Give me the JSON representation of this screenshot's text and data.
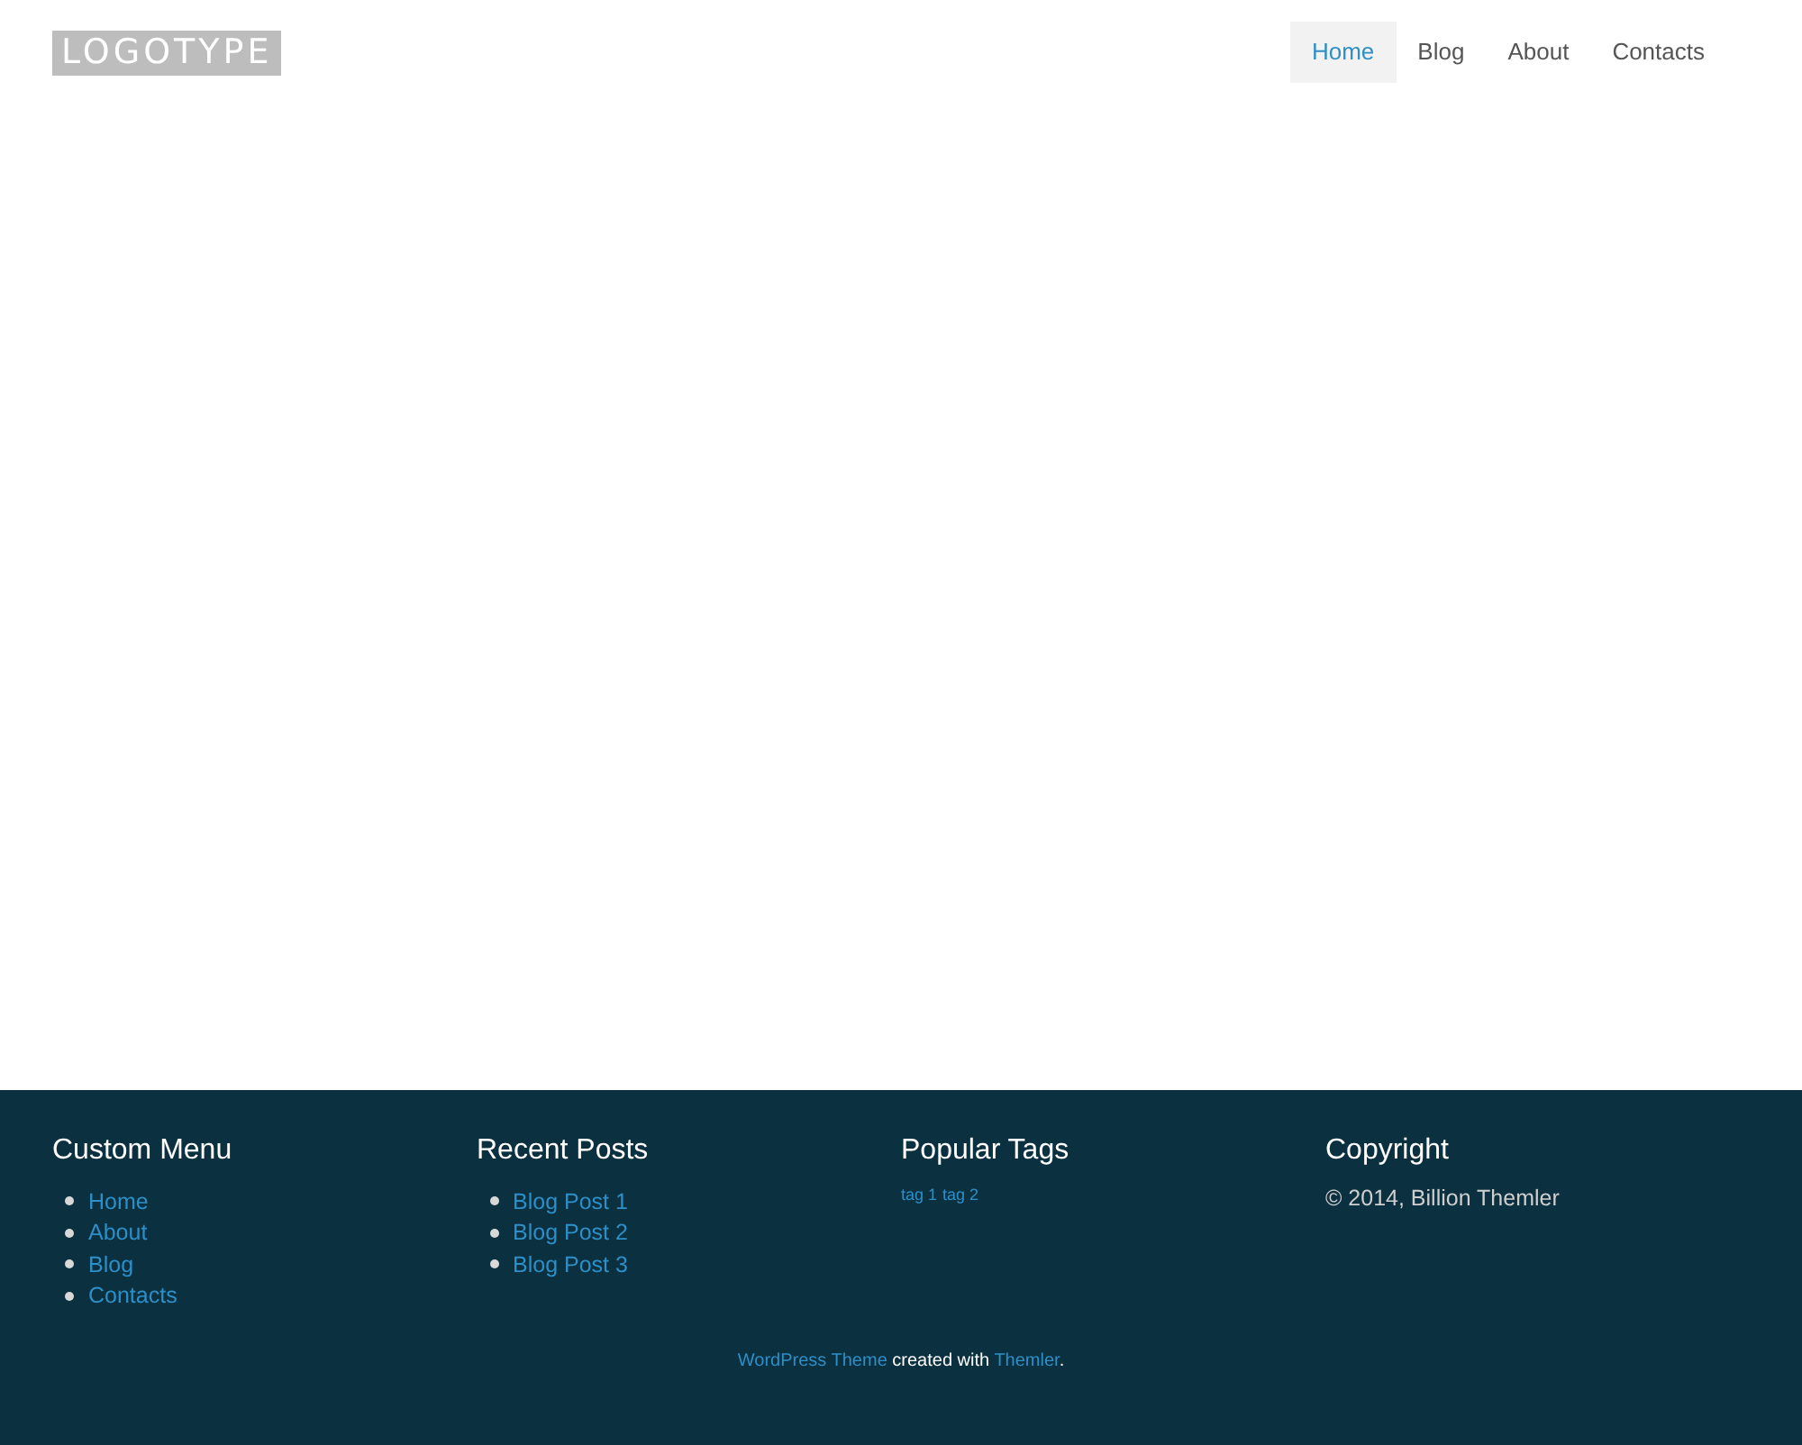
{
  "header": {
    "logo": "LOGOTYPE",
    "nav": [
      {
        "label": "Home",
        "selected": true
      },
      {
        "label": "Blog",
        "selected": false
      },
      {
        "label": "About",
        "selected": false
      },
      {
        "label": "Contacts",
        "selected": false
      }
    ]
  },
  "footer": {
    "widgets": [
      {
        "kind": "list",
        "title": "Custom Menu",
        "items": [
          "Home",
          "About",
          "Blog",
          "Contacts"
        ]
      },
      {
        "kind": "list",
        "title": "Recent Posts",
        "items": [
          "Blog Post 1",
          "Blog Post 2",
          "Blog Post 3"
        ]
      },
      {
        "kind": "tags",
        "title": "Popular Tags",
        "items": [
          "tag 1",
          "tag 2"
        ]
      },
      {
        "kind": "text",
        "title": "Copyright",
        "text": "© 2014, Billion Themler"
      }
    ],
    "credit": [
      {
        "kind": "link",
        "text": "WordPress Theme"
      },
      {
        "kind": "text",
        "text": " created with "
      },
      {
        "kind": "link",
        "text": "Themler"
      },
      {
        "kind": "text",
        "text": "."
      }
    ]
  }
}
